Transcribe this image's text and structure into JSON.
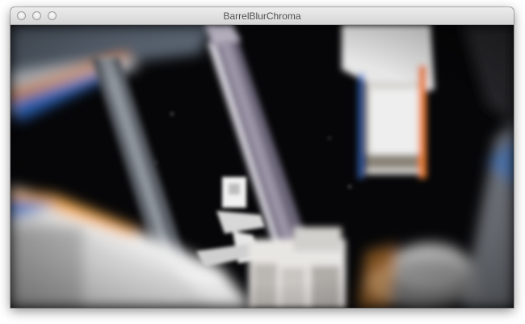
{
  "window": {
    "title": "BarrelBlurChroma"
  },
  "icons": {
    "close": "close-window-icon",
    "minimize": "minimize-window-icon",
    "zoom": "zoom-window-icon"
  },
  "colors": {
    "titlebar_top": "#ececec",
    "titlebar_bottom": "#d6d6d6",
    "title_text": "#4b4b4b",
    "space": "#050507"
  }
}
